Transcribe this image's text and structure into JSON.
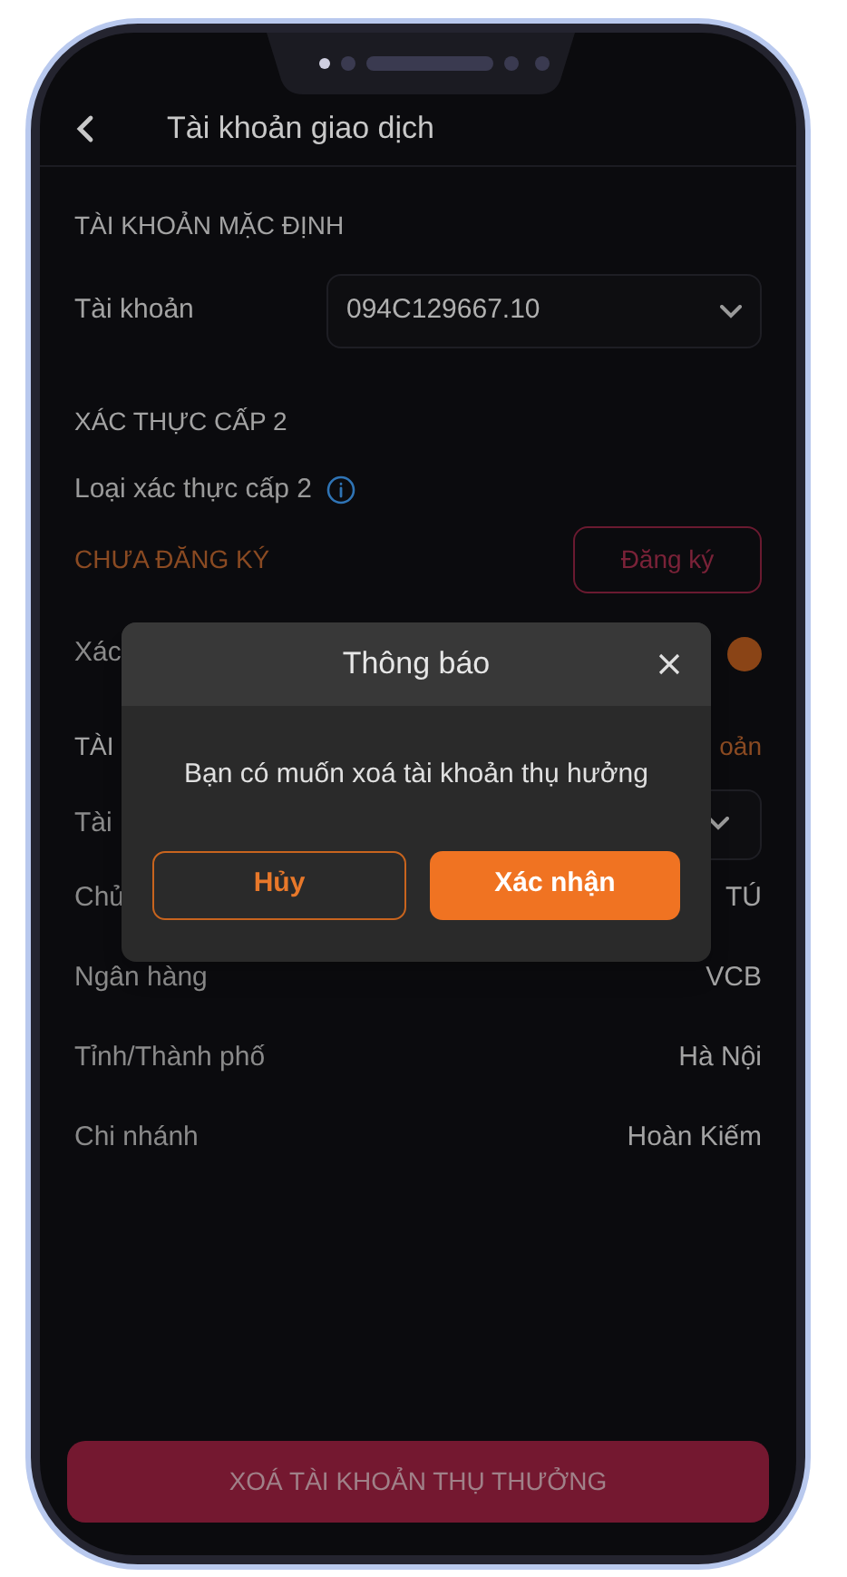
{
  "header": {
    "title": "Tài khoản giao dịch"
  },
  "default_account": {
    "section": "TÀI KHOẢN MẶC ĐỊNH",
    "label": "Tài khoản",
    "value": "094C129667.10"
  },
  "auth": {
    "section": "XÁC THỰC CẤP 2",
    "type_label": "Loại xác thực cấp 2",
    "status": "CHƯA ĐĂNG KÝ",
    "register_button": "Đăng ký",
    "toggle_label": "Xác",
    "toggle_on": true
  },
  "beneficiary": {
    "section": "TÀI",
    "action": "oản",
    "account_label": "Tài",
    "rows": [
      {
        "label": "Chủ",
        "value": "TÚ"
      },
      {
        "label": "Ngân hàng",
        "value": "VCB"
      },
      {
        "label": "Tỉnh/Thành phố",
        "value": "Hà Nội"
      },
      {
        "label": "Chi nhánh",
        "value": "Hoàn Kiếm"
      }
    ]
  },
  "delete_button": "XOÁ TÀI KHOẢN THỤ THƯỞNG",
  "dialog": {
    "title": "Thông báo",
    "message": "Bạn có muốn xoá tài khoản thụ hưởng",
    "buttons": [
      {
        "label": "Hủy",
        "kind": "secondary"
      },
      {
        "label": "Xác nhận",
        "kind": "primary"
      }
    ]
  }
}
